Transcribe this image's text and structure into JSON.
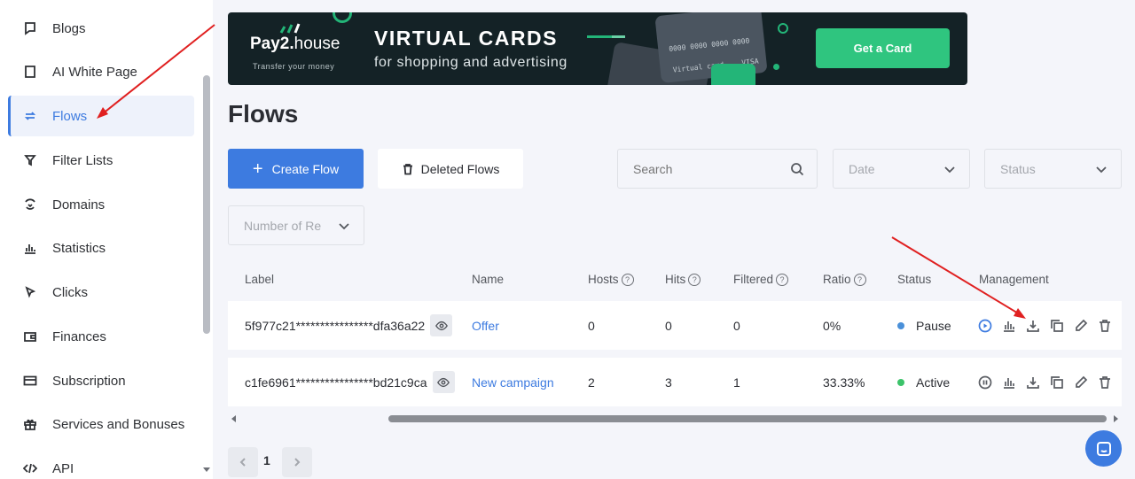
{
  "sidebar": {
    "items": [
      {
        "label": "Blogs",
        "icon": "blog-icon"
      },
      {
        "label": "AI White Page",
        "icon": "page-icon"
      },
      {
        "label": "Flows",
        "icon": "flows-icon",
        "active": true
      },
      {
        "label": "Filter Lists",
        "icon": "filter-icon"
      },
      {
        "label": "Domains",
        "icon": "domains-icon"
      },
      {
        "label": "Statistics",
        "icon": "statistics-icon"
      },
      {
        "label": "Clicks",
        "icon": "cursor-icon"
      },
      {
        "label": "Finances",
        "icon": "wallet-icon"
      },
      {
        "label": "Subscription",
        "icon": "card-icon"
      },
      {
        "label": "Services and Bonuses",
        "icon": "gift-icon"
      },
      {
        "label": "API",
        "icon": "code-icon"
      }
    ]
  },
  "banner": {
    "logo_bold": "Pay2.",
    "logo_thin": "house",
    "tagline": "Transfer your money",
    "headline": "VIRTUAL CARDS",
    "subhead": "for shopping and advertising",
    "card_number": "0000 0000 0000 0000",
    "card_label": "Virtual card",
    "card_brand": "VISA",
    "cta": "Get a Card"
  },
  "page": {
    "title": "Flows"
  },
  "toolbar": {
    "create_label": "Create Flow",
    "deleted_label": "Deleted Flows"
  },
  "filters": {
    "search_placeholder": "Search",
    "date_placeholder": "Date",
    "status_placeholder": "Status",
    "records_placeholder": "Number of Re"
  },
  "table": {
    "columns": {
      "label": "Label",
      "name": "Name",
      "hosts": "Hosts",
      "hits": "Hits",
      "filtered": "Filtered",
      "ratio": "Ratio",
      "status": "Status",
      "management": "Management"
    },
    "help_glyph": "?",
    "rows": [
      {
        "label": "5f977c21****************dfa36a22",
        "name": "Offer",
        "hosts": "0",
        "hits": "0",
        "filtered": "0",
        "ratio": "0%",
        "status": "Pause",
        "status_color": "#4a90d9"
      },
      {
        "label": "c1fe6961****************bd21c9ca",
        "name": "New campaign",
        "hosts": "2",
        "hits": "3",
        "filtered": "1",
        "ratio": "33.33%",
        "status": "Active",
        "status_color": "#3cc36a"
      }
    ]
  },
  "pagination": {
    "current": "1"
  },
  "colors": {
    "accent": "#3d7be0",
    "annotation_arrow": "#e02020"
  }
}
